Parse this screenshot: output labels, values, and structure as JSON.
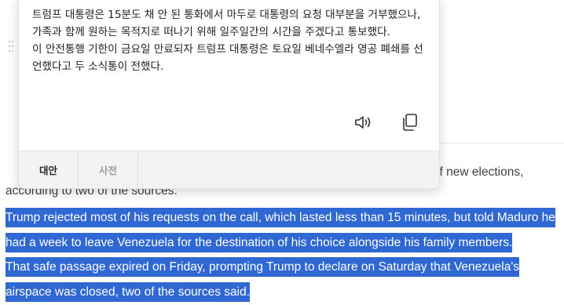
{
  "article": {
    "partial_line_end": "d of new elections,",
    "partial_line_start": "according to two of the sources.",
    "para1": "Trump rejected most of his requests on the call, which lasted less than 15 minutes, but told Maduro he had a week to leave Venezuela for the destination of his choice alongside his family members.",
    "para2": "That safe passage expired on Friday, prompting Trump to declare on Saturday that Venezuela's airspace was closed, two of the sources said."
  },
  "popup": {
    "translation_line1": "트럼프 대통령은 15분도 채 안 된 통화에서 마두로 대통령의 요청 대부분을 거부했으나, 가족과 함께 원하는 목적지로 떠나기 위해 일주일간의 시간을 주겠다고 통보했다.",
    "translation_line2": "이 안전통행 기한이 금요일 만료되자 트럼프 대통령은 토요일 베네수엘라 영공 폐쇄를 선언했다고 두 소식통이 전했다.",
    "tabs": [
      "대안",
      "사전"
    ],
    "icons": {
      "speaker": "speaker-icon",
      "copy": "copy-icon",
      "drag": "drag-handle-icon"
    }
  },
  "colors": {
    "selection": "#2f67d3",
    "tab_bar": "#f3f3f3"
  }
}
